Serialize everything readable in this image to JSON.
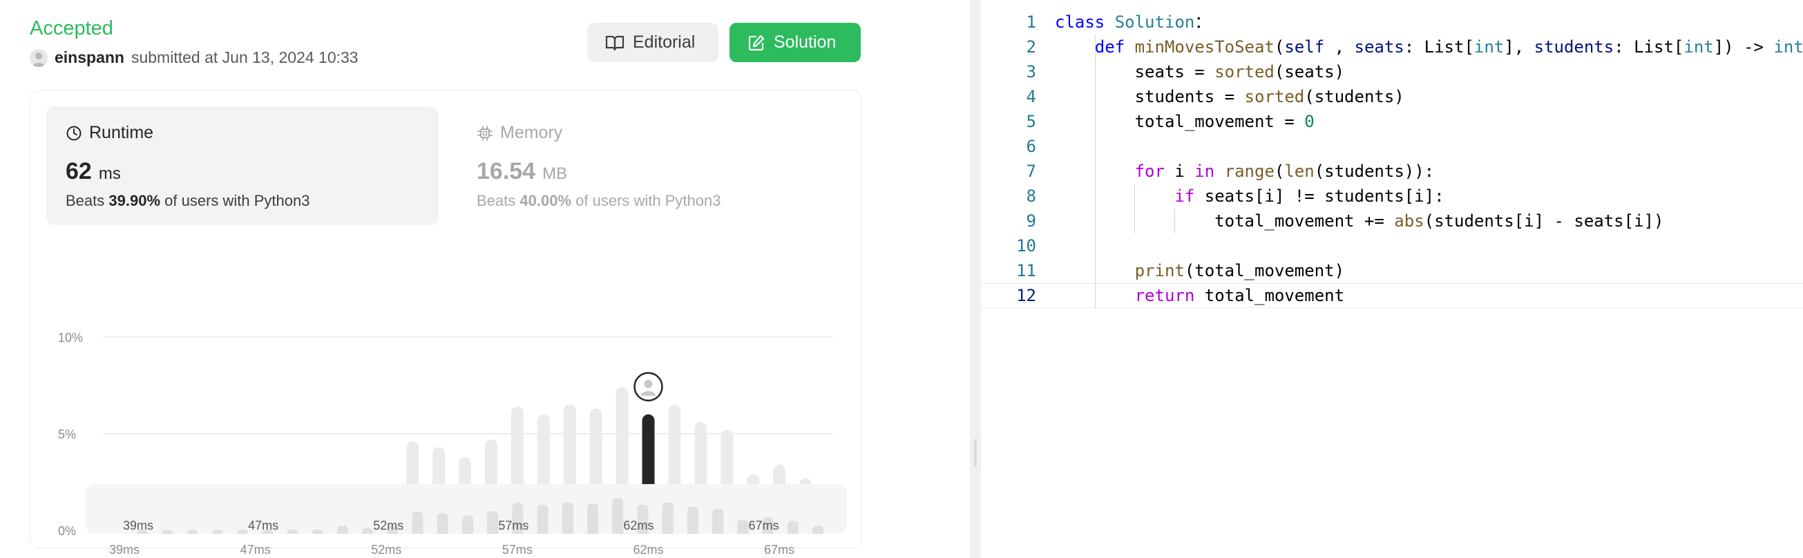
{
  "status": "Accepted",
  "submission": {
    "user": "einspann",
    "text": "submitted at Jun 13, 2024 10:33"
  },
  "buttons": {
    "editorial": "Editorial",
    "solution": "Solution"
  },
  "runtime": {
    "title": "Runtime",
    "value": "62",
    "unit": "ms",
    "beats_prefix": "Beats",
    "beats": "39.90%",
    "beats_suffix": "of users with Python3"
  },
  "memory": {
    "title": "Memory",
    "value": "16.54",
    "unit": "MB",
    "beats_prefix": "Beats",
    "beats": "40.00%",
    "beats_suffix": "of users with Python3"
  },
  "colors": {
    "accent": "#2cbb5d",
    "bar": "#ebebeb",
    "bar_active": "#262626",
    "mini_bar": "#e0e0e0"
  },
  "chart_data": {
    "type": "bar",
    "categories": [
      "39ms",
      "",
      "",
      "",
      "",
      "47ms",
      "",
      "",
      "",
      "",
      "52ms",
      "",
      "",
      "",
      "",
      "57ms",
      "",
      "",
      "",
      "",
      "62ms",
      "",
      "",
      "",
      "",
      "67ms",
      "",
      "",
      ""
    ],
    "values": [
      0.3,
      0.3,
      0.3,
      0.3,
      0.3,
      0.6,
      0.9,
      0.9,
      1.7,
      1.2,
      1.8,
      4.6,
      4.3,
      3.8,
      4.7,
      6.4,
      6.0,
      6.5,
      6.3,
      7.4,
      6.0,
      6.5,
      5.6,
      5.2,
      2.9,
      3.4,
      2.7,
      1.7
    ],
    "highlight_index": 20,
    "y_ticks": [
      "0%",
      "5%",
      "10%"
    ],
    "ylim": [
      0,
      10
    ],
    "mini_values": [
      0.3,
      0.3,
      0.3,
      0.3,
      0.3,
      0.6,
      0.9,
      0.9,
      1.7,
      1.2,
      1.8,
      4.6,
      4.3,
      3.8,
      4.7,
      6.4,
      6.0,
      6.5,
      6.3,
      7.4,
      6.0,
      6.5,
      5.6,
      5.2,
      2.9,
      3.4,
      2.7,
      1.7
    ],
    "mini_labels": [
      "39ms",
      "47ms",
      "52ms",
      "57ms",
      "62ms",
      "67ms"
    ]
  },
  "code": {
    "lines": [
      {
        "n": "1",
        "tokens": [
          [
            "kw",
            "class "
          ],
          [
            "cls",
            "Solution"
          ],
          [
            "",
            "："
          ]
        ]
      },
      {
        "n": "2",
        "tokens": [
          [
            "",
            "    "
          ],
          [
            "kw",
            "def "
          ],
          [
            "fn",
            "minMovesToSeat"
          ],
          [
            "",
            "("
          ],
          [
            "par",
            "self"
          ],
          [
            "",
            " , "
          ],
          [
            "par",
            "seats"
          ],
          [
            "",
            ": List["
          ],
          [
            "cls",
            "int"
          ],
          [
            "",
            "], "
          ],
          [
            "par",
            "students"
          ],
          [
            "",
            ": List["
          ],
          [
            "cls",
            "int"
          ],
          [
            "",
            "]) -> "
          ],
          [
            "cls",
            "int"
          ],
          [
            "",
            ":"
          ]
        ]
      },
      {
        "n": "3",
        "tokens": [
          [
            "",
            "        seats = "
          ],
          [
            "fn",
            "sorted"
          ],
          [
            "",
            "(seats)"
          ]
        ]
      },
      {
        "n": "4",
        "tokens": [
          [
            "",
            "        students = "
          ],
          [
            "fn",
            "sorted"
          ],
          [
            "",
            "(students)"
          ]
        ]
      },
      {
        "n": "5",
        "tokens": [
          [
            "",
            "        total_movement = "
          ],
          [
            "num",
            "0"
          ]
        ]
      },
      {
        "n": "6",
        "tokens": []
      },
      {
        "n": "7",
        "tokens": [
          [
            "",
            "        "
          ],
          [
            "kw2",
            "for "
          ],
          [
            "",
            "i "
          ],
          [
            "kw2",
            "in "
          ],
          [
            "fn",
            "range"
          ],
          [
            "",
            "("
          ],
          [
            "fn",
            "len"
          ],
          [
            "",
            "(students)):"
          ]
        ]
      },
      {
        "n": "8",
        "tokens": [
          [
            "",
            "            "
          ],
          [
            "kw2",
            "if "
          ],
          [
            "",
            "seats[i] != students[i]:"
          ]
        ]
      },
      {
        "n": "9",
        "tokens": [
          [
            "",
            "                total_movement += "
          ],
          [
            "fn",
            "abs"
          ],
          [
            "",
            "(students[i] - seats[i])"
          ]
        ]
      },
      {
        "n": "10",
        "tokens": []
      },
      {
        "n": "11",
        "tokens": [
          [
            "",
            "        "
          ],
          [
            "fn",
            "print"
          ],
          [
            "",
            "(total_movement)"
          ]
        ]
      },
      {
        "n": "12",
        "tokens": [
          [
            "",
            "        "
          ],
          [
            "kw2",
            "return "
          ],
          [
            "",
            "total_movement"
          ]
        ]
      }
    ]
  }
}
